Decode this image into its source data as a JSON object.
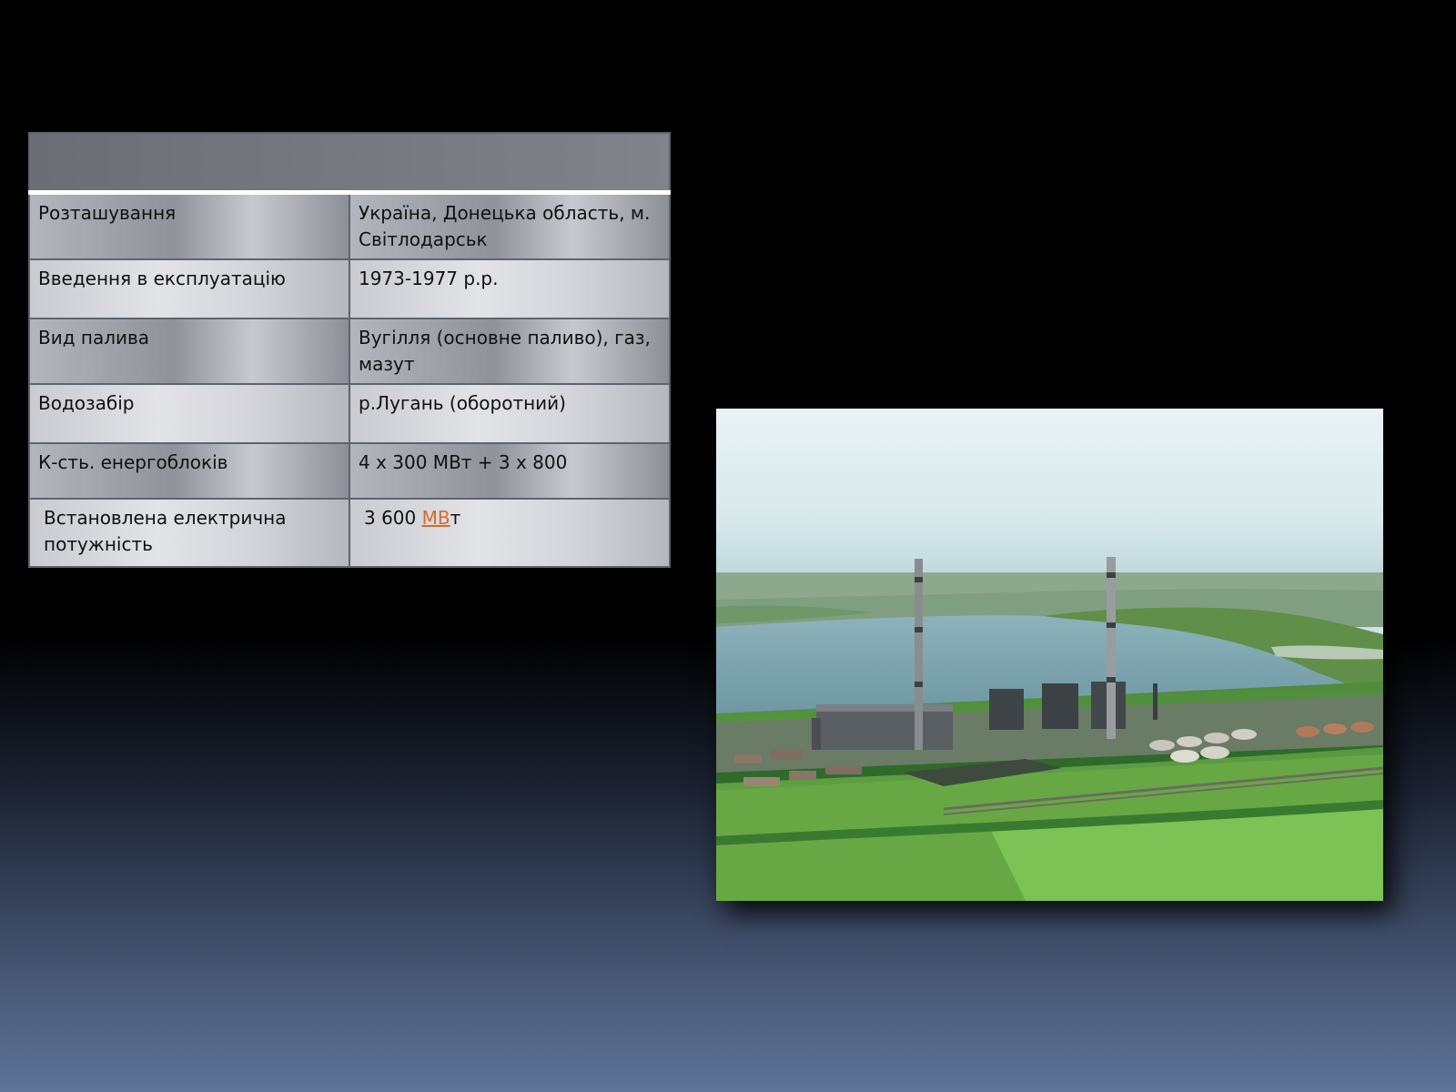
{
  "table": {
    "header": "",
    "rows": [
      {
        "label": "Розташування",
        "value": " Україна, Донецька область, м. Світлодарськ"
      },
      {
        "label": "Введення в експлуатацію",
        "value": "1973-1977 р.р."
      },
      {
        "label": "Вид палива",
        "value": "Вугілля (основне паливо), газ, мазут"
      },
      {
        "label": "Водозабір",
        "value": "р.Лугань (оборотний)"
      },
      {
        "label": "К-сть. енергоблоків",
        "value": "4 х 300 МВт + 3 х 800"
      },
      {
        "label": "Встановлена електрична потужність",
        "value_number": "3 600 ",
        "value_link": "МВ",
        "value_suffix": "т"
      }
    ]
  },
  "colors": {
    "link": "#d86a2c",
    "table_header": "#75787f"
  },
  "photo": {
    "subject": "power-plant-aerial-photo"
  }
}
